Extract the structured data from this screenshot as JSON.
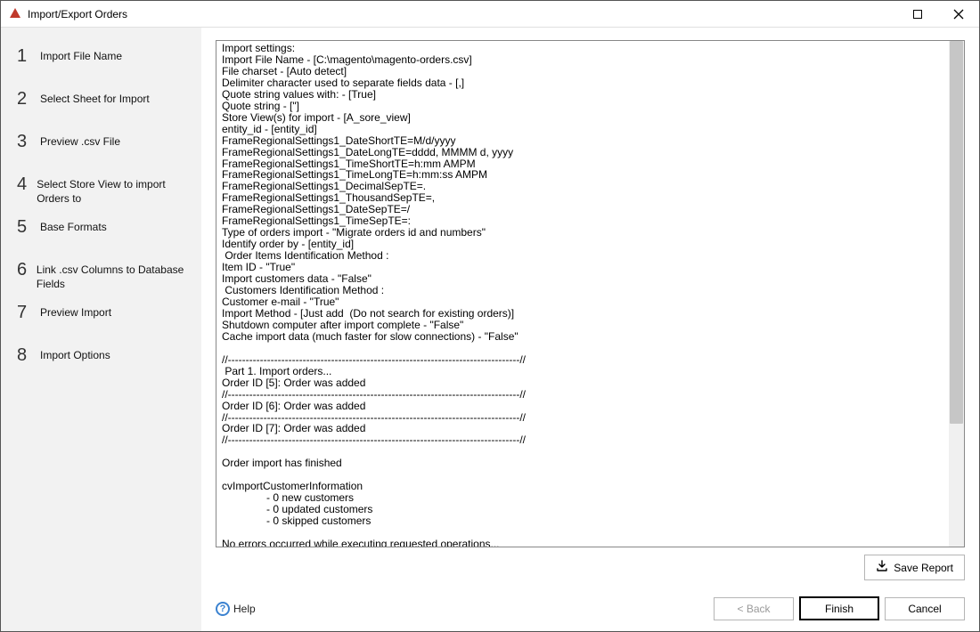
{
  "window": {
    "title": "Import/Export Orders"
  },
  "sidebar": {
    "steps": [
      {
        "num": "1",
        "label": "Import File Name"
      },
      {
        "num": "2",
        "label": "Select Sheet for Import"
      },
      {
        "num": "3",
        "label": "Preview .csv File"
      },
      {
        "num": "4",
        "label": "Select Store View to import Orders to"
      },
      {
        "num": "5",
        "label": "Base Formats"
      },
      {
        "num": "6",
        "label": "Link .csv Columns to Database Fields"
      },
      {
        "num": "7",
        "label": "Preview Import"
      },
      {
        "num": "8",
        "label": "Import Options"
      }
    ]
  },
  "log": {
    "text": "Import settings:\nImport File Name - [C:\\magento\\magento-orders.csv]\nFile charset - [Auto detect]\nDelimiter character used to separate fields data - [,]\nQuote string values with: - [True]\nQuote string - [\"]\nStore View(s) for import - [A_sore_view]\nentity_id - [entity_id]\nFrameRegionalSettings1_DateShortTE=M/d/yyyy\nFrameRegionalSettings1_DateLongTE=dddd, MMMM d, yyyy\nFrameRegionalSettings1_TimeShortTE=h:mm AMPM\nFrameRegionalSettings1_TimeLongTE=h:mm:ss AMPM\nFrameRegionalSettings1_DecimalSepTE=.\nFrameRegionalSettings1_ThousandSepTE=,\nFrameRegionalSettings1_DateSepTE=/\nFrameRegionalSettings1_TimeSepTE=:\nType of orders import - \"Migrate orders id and numbers\"\nIdentify order by - [entity_id]\n Order Items Identification Method :\nItem ID - \"True\"\nImport customers data - \"False\"\n Customers Identification Method :\nCustomer e-mail - \"True\"\nImport Method - [Just add  (Do not search for existing orders)]\nShutdown computer after import complete - \"False\"\nCache import data (much faster for slow connections) - \"False\"\n\n//----------------------------------------------------------------------------------//\n Part 1. Import orders...\nOrder ID [5]: Order was added\n//----------------------------------------------------------------------------------//\nOrder ID [6]: Order was added\n//----------------------------------------------------------------------------------//\nOrder ID [7]: Order was added\n//----------------------------------------------------------------------------------//\n\nOrder import has finished\n\ncvImportCustomerInformation\n               - 0 new customers\n               - 0 updated customers\n               - 0 skipped customers\n\nNo errors occurred while executing requested operations..."
  },
  "buttons": {
    "save_report": "Save Report",
    "help": "Help",
    "back": "< Back",
    "finish": "Finish",
    "cancel": "Cancel"
  }
}
